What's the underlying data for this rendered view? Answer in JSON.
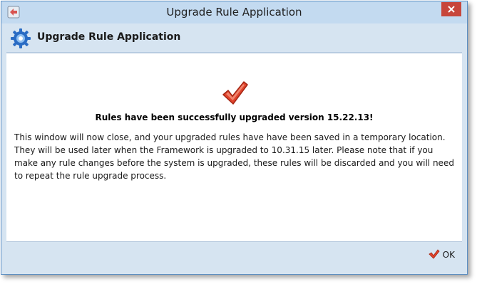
{
  "window": {
    "title": "Upgrade Rule Application"
  },
  "header": {
    "title": "Upgrade Rule Application"
  },
  "content": {
    "headline": "Rules have been successfully upgraded version 15.22.13!",
    "message": "This window will now close, and your upgraded rules have have been saved in a temporary location. They will be used later when the Framework is upgraded to 10.31.15 later. Please note that if you make any rule changes before the system is upgraded, these rules will be discarded and you will need to repeat the rule upgrade process."
  },
  "footer": {
    "ok_label": "OK"
  },
  "icons": {
    "app": "app-icon",
    "gear": "gear-icon",
    "success": "checkmark-icon",
    "close": "close-icon",
    "ok": "checkmark-icon"
  },
  "colors": {
    "close_button": "#c7463b",
    "check": "#e0432c",
    "window_chrome": "#d6e4f1"
  }
}
